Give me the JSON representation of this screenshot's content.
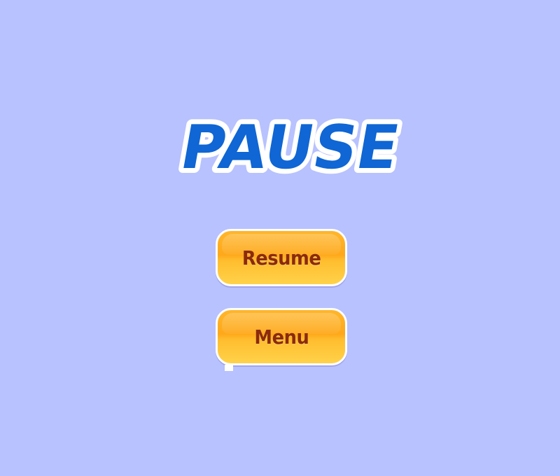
{
  "pause_menu": {
    "title": "PAUSE",
    "resume_label": "Resume",
    "menu_label": "Menu"
  },
  "colors": {
    "background": "#b7c2fe",
    "title_fill": "#0f66d4",
    "title_outline": "#ffffff",
    "button_fill": "#ffb122",
    "button_border": "#ffffff",
    "button_text": "#8b2a0c"
  }
}
